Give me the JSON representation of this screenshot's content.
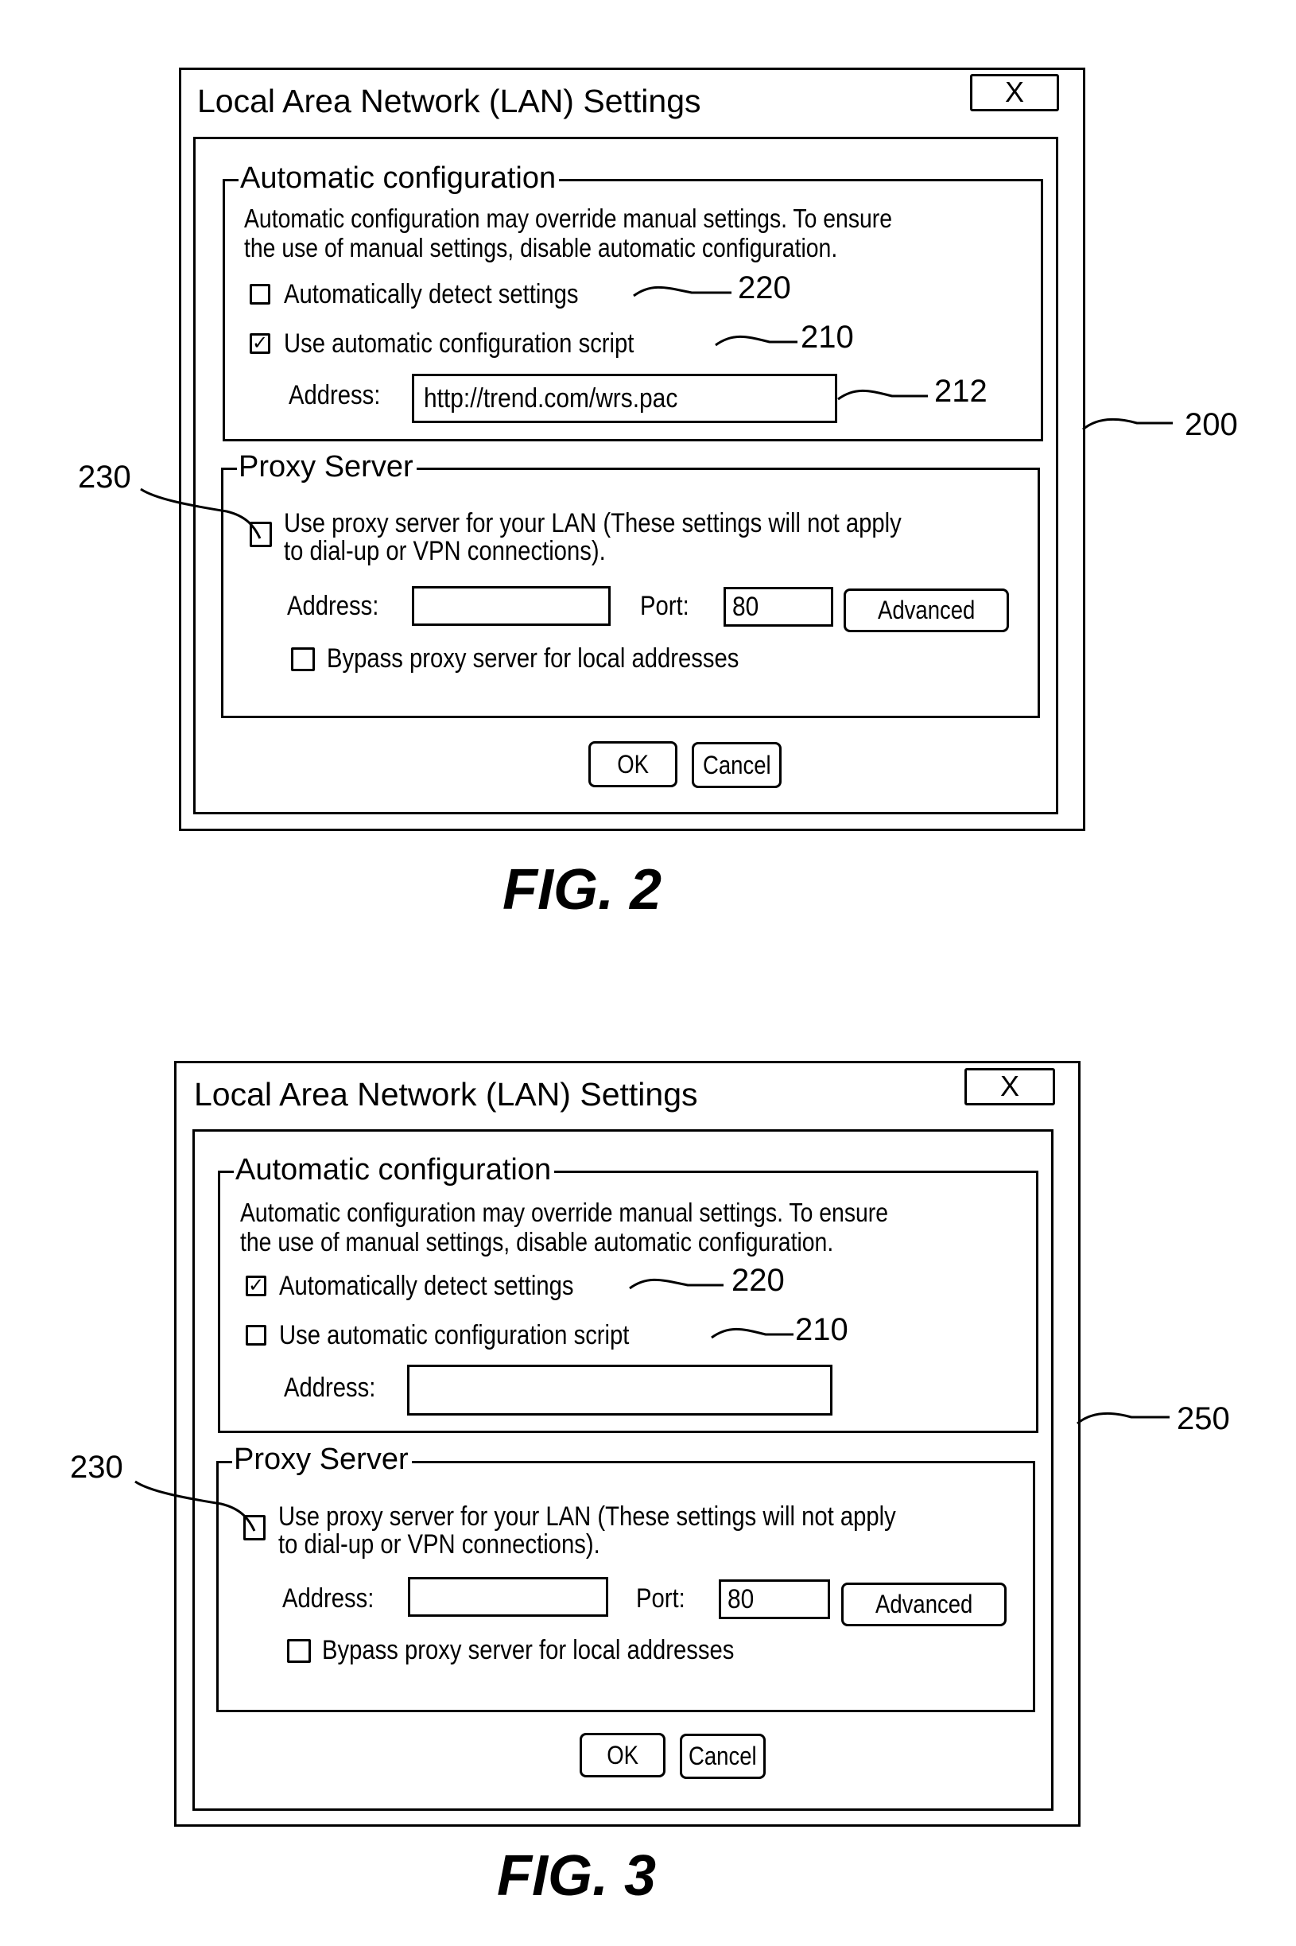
{
  "figures": [
    {
      "fig_label": "FIG. 2",
      "ref_dialog": "200",
      "dialog": {
        "title": "Local Area Network (LAN) Settings",
        "close_label": "X",
        "auto_config": {
          "legend": "Automatic configuration",
          "description_line1": "Automatic configuration may override manual settings. To ensure",
          "description_line2": "the use of manual settings, disable automatic configuration.",
          "auto_detect": {
            "label": "Automatically detect settings",
            "checked": false,
            "check_glyph": "",
            "ref": "220"
          },
          "use_script": {
            "label": "Use automatic configuration script",
            "checked": true,
            "check_glyph": "✓",
            "ref": "210"
          },
          "address_label": "Address:",
          "address_value": "http://trend.com/wrs.pac",
          "address_ref": "212"
        },
        "proxy": {
          "legend": "Proxy Server",
          "use_proxy": {
            "label_line1": "Use proxy server for your LAN (These settings will not apply",
            "label_line2": "to dial-up or VPN connections).",
            "checked": false,
            "check_glyph": "",
            "ref": "230"
          },
          "address_label": "Address:",
          "address_value": "",
          "port_label": "Port:",
          "port_value": "80",
          "advanced_label": "Advanced",
          "bypass": {
            "label": "Bypass proxy server for local addresses",
            "checked": false,
            "check_glyph": ""
          }
        },
        "ok_label": "OK",
        "cancel_label": "Cancel"
      }
    },
    {
      "fig_label": "FIG. 3",
      "ref_dialog": "250",
      "dialog": {
        "title": "Local Area Network (LAN) Settings",
        "close_label": "X",
        "auto_config": {
          "legend": "Automatic configuration",
          "description_line1": "Automatic configuration may override manual settings. To ensure",
          "description_line2": "the use of manual settings, disable automatic configuration.",
          "auto_detect": {
            "label": "Automatically detect settings",
            "checked": true,
            "check_glyph": "✓",
            "ref": "220"
          },
          "use_script": {
            "label": "Use automatic configuration script",
            "checked": false,
            "check_glyph": "",
            "ref": "210"
          },
          "address_label": "Address:",
          "address_value": "",
          "address_ref": ""
        },
        "proxy": {
          "legend": "Proxy Server",
          "use_proxy": {
            "label_line1": "Use proxy server for your LAN (These settings will not apply",
            "label_line2": "to dial-up or VPN connections).",
            "checked": false,
            "check_glyph": "",
            "ref": "230"
          },
          "address_label": "Address:",
          "address_value": "",
          "port_label": "Port:",
          "port_value": "80",
          "advanced_label": "Advanced",
          "bypass": {
            "label": "Bypass proxy server for local addresses",
            "checked": false,
            "check_glyph": ""
          }
        },
        "ok_label": "OK",
        "cancel_label": "Cancel"
      }
    }
  ]
}
